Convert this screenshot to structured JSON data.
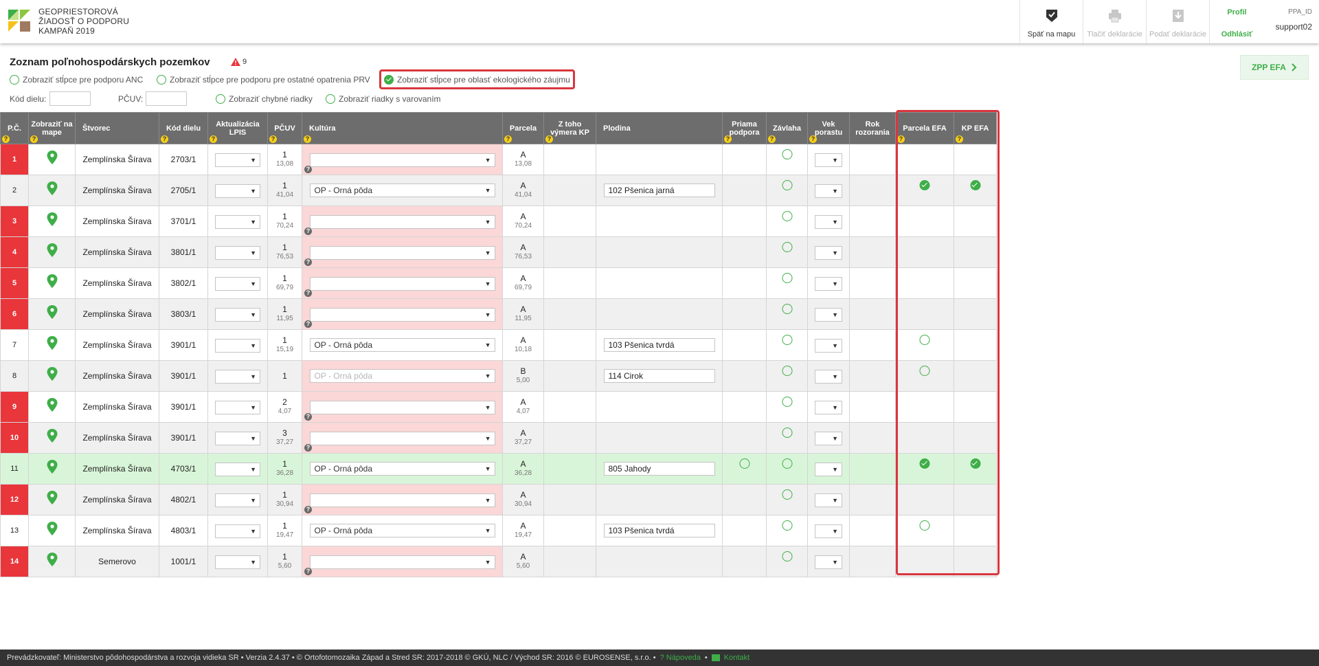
{
  "app": {
    "title_lines": [
      "GEOPRIESTOROVÁ",
      "ŽIADOSŤ O PODPORU",
      "KAMPAŇ 2019"
    ],
    "colors": {
      "accent": "#3fae49",
      "error": "#e8363b",
      "highlight": "#d9363e",
      "header_bg": "#6d6d6d"
    }
  },
  "header": {
    "back_map": "Späť na mapu",
    "print_decl": "Tlačiť deklarácie",
    "submit_decl": "Podať deklarácie",
    "profile": "Profil",
    "logout": "Odhlásiť",
    "user_label": "PPA_ID",
    "user_name": "support02"
  },
  "page": {
    "title": "Zoznam poľnohospodárskych pozemkov",
    "warning_count": "9",
    "zpp_button": "ZPP EFA"
  },
  "filters": {
    "anc": "Zobraziť stĺpce pre podporu ANC",
    "prv": "Zobraziť stĺpce pre podporu pre ostatné opatrenia PRV",
    "efa": "Zobraziť stĺpce pre oblasť ekologického záujmu",
    "errors": "Zobraziť chybné riadky",
    "warnings": "Zobraziť riadky s varovaním",
    "kod_dielu_label": "Kód dielu:",
    "pcuv_label": "PČUV:"
  },
  "columns": {
    "pc": "P.Č.",
    "zobrazit": "Zobraziť na mape",
    "stvorec": "Štvorec",
    "kod": "Kód dielu",
    "aktualizacia": "Aktualizácia LPIS",
    "pcuv": "PČUV",
    "kultura": "Kultúra",
    "parcela": "Parcela",
    "ztoho": "Z toho výmera KP",
    "plodina": "Plodina",
    "priama": "Priama podpora",
    "zavlaha": "Závlaha",
    "vek": "Vek porastu",
    "rok": "Rok rozorania",
    "parcela_efa": "Parcela EFA",
    "kp_efa": "KP EFA"
  },
  "rows": [
    {
      "pc": "1",
      "err": true,
      "stvorec": "Zemplínska Šírava",
      "kod": "2703/1",
      "pcuv": "1",
      "pcuv_area": "13,08",
      "kultura": "",
      "parcela": "A",
      "parcela_area": "13,08",
      "plodina": "",
      "priama": "",
      "efa_parcela": "",
      "efa_kp": ""
    },
    {
      "pc": "2",
      "err": false,
      "stvorec": "Zemplínska Šírava",
      "kod": "2705/1",
      "pcuv": "1",
      "pcuv_area": "41,04",
      "kultura": "OP - Orná pôda",
      "parcela": "A",
      "parcela_area": "41,04",
      "plodina": "102  Pšenica jarná",
      "priama": "",
      "efa_parcela": "check",
      "efa_kp": "check"
    },
    {
      "pc": "3",
      "err": true,
      "stvorec": "Zemplínska Šírava",
      "kod": "3701/1",
      "pcuv": "1",
      "pcuv_area": "70,24",
      "kultura": "",
      "parcela": "A",
      "parcela_area": "70,24",
      "plodina": "",
      "priama": "",
      "efa_parcela": "",
      "efa_kp": ""
    },
    {
      "pc": "4",
      "err": true,
      "stvorec": "Zemplínska Šírava",
      "kod": "3801/1",
      "pcuv": "1",
      "pcuv_area": "76,53",
      "kultura": "",
      "parcela": "A",
      "parcela_area": "76,53",
      "plodina": "",
      "priama": "",
      "efa_parcela": "",
      "efa_kp": ""
    },
    {
      "pc": "5",
      "err": true,
      "stvorec": "Zemplínska Šírava",
      "kod": "3802/1",
      "pcuv": "1",
      "pcuv_area": "69,79",
      "kultura": "",
      "parcela": "A",
      "parcela_area": "69,79",
      "plodina": "",
      "priama": "",
      "efa_parcela": "",
      "efa_kp": ""
    },
    {
      "pc": "6",
      "err": true,
      "stvorec": "Zemplínska Šírava",
      "kod": "3803/1",
      "pcuv": "1",
      "pcuv_area": "11,95",
      "kultura": "",
      "parcela": "A",
      "parcela_area": "11,95",
      "plodina": "",
      "priama": "",
      "efa_parcela": "",
      "efa_kp": ""
    },
    {
      "pc": "7",
      "err": false,
      "stvorec": "Zemplínska Šírava",
      "kod": "3901/1",
      "pcuv": "1",
      "pcuv_area": "15,19",
      "kultura": "OP - Orná pôda",
      "parcela": "A",
      "parcela_area": "10,18",
      "plodina": "103  Pšenica tvrdá",
      "priama": "",
      "efa_parcela": "circle",
      "efa_kp": ""
    },
    {
      "pc": "8",
      "err": false,
      "stvorec": "Zemplínska Šírava",
      "kod": "3901/1",
      "pcuv": "1",
      "pcuv_area": "",
      "kultura": "OP - Orná pôda",
      "kultura_disabled": true,
      "parcela": "B",
      "parcela_area": "5,00",
      "plodina": "114  Cirok",
      "priama": "",
      "efa_parcela": "circle",
      "efa_kp": ""
    },
    {
      "pc": "9",
      "err": true,
      "stvorec": "Zemplínska Šírava",
      "kod": "3901/1",
      "pcuv": "2",
      "pcuv_area": "4,07",
      "kultura": "",
      "parcela": "A",
      "parcela_area": "4,07",
      "plodina": "",
      "priama": "",
      "efa_parcela": "",
      "efa_kp": ""
    },
    {
      "pc": "10",
      "err": true,
      "stvorec": "Zemplínska Šírava",
      "kod": "3901/1",
      "pcuv": "3",
      "pcuv_area": "37,27",
      "kultura": "",
      "parcela": "A",
      "parcela_area": "37,27",
      "plodina": "",
      "priama": "",
      "efa_parcela": "",
      "efa_kp": ""
    },
    {
      "pc": "11",
      "err": false,
      "green": true,
      "stvorec": "Zemplínska Šírava",
      "kod": "4703/1",
      "pcuv": "1",
      "pcuv_area": "36,28",
      "kultura": "OP - Orná pôda",
      "parcela": "A",
      "parcela_area": "36,28",
      "plodina": "805  Jahody",
      "priama": "circle",
      "efa_parcela": "check",
      "efa_kp": "check"
    },
    {
      "pc": "12",
      "err": true,
      "stvorec": "Zemplínska Šírava",
      "kod": "4802/1",
      "pcuv": "1",
      "pcuv_area": "30,94",
      "kultura": "",
      "parcela": "A",
      "parcela_area": "30,94",
      "plodina": "",
      "priama": "",
      "efa_parcela": "",
      "efa_kp": ""
    },
    {
      "pc": "13",
      "err": false,
      "stvorec": "Zemplínska Šírava",
      "kod": "4803/1",
      "pcuv": "1",
      "pcuv_area": "19,47",
      "kultura": "OP - Orná pôda",
      "parcela": "A",
      "parcela_area": "19,47",
      "plodina": "103  Pšenica tvrdá",
      "priama": "",
      "efa_parcela": "circle",
      "efa_kp": ""
    },
    {
      "pc": "14",
      "err": true,
      "stvorec": "Semerovo",
      "kod": "1001/1",
      "pcuv": "1",
      "pcuv_area": "5,60",
      "kultura": "",
      "parcela": "A",
      "parcela_area": "5,60",
      "plodina": "",
      "priama": "",
      "efa_parcela": "",
      "efa_kp": ""
    }
  ],
  "footer": {
    "text": "Prevádzkovateľ: Ministerstvo pôdohospodárstva a rozvoja vidieka SR • Verzia 2.4.37 • © Ortofotomozaika Západ a Stred SR: 2017-2018 © GKÚ, NLC / Východ SR: 2016 © EUROSENSE, s.r.o. •",
    "help": "Nápoveda",
    "contact": "Kontakt"
  }
}
